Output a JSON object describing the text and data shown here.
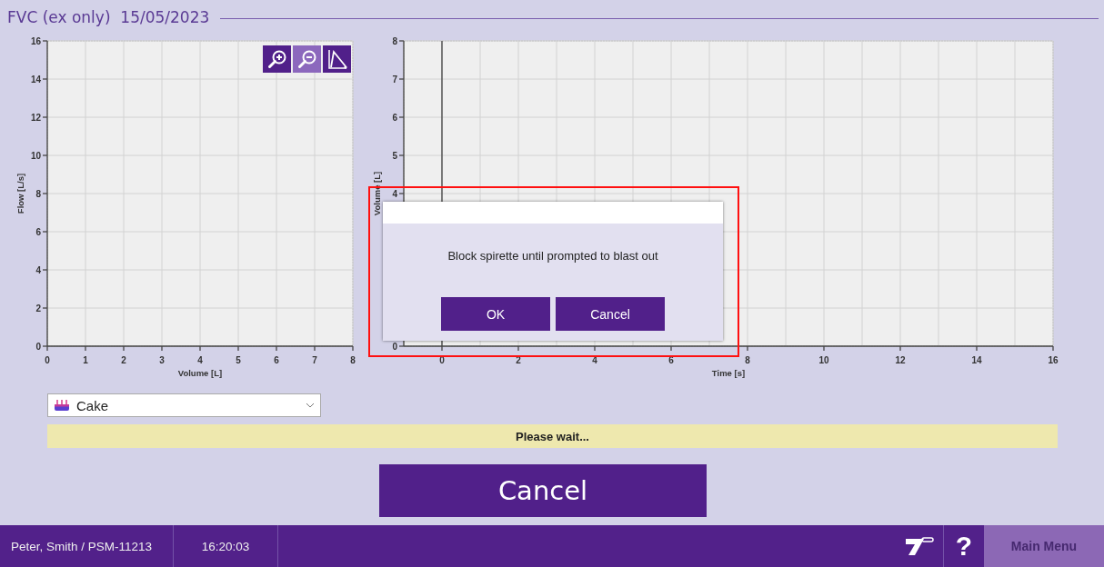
{
  "header": {
    "title": "FVC (ex only)  15/05/2023"
  },
  "charts": [
    {
      "toolbar": [
        {
          "kind": "zoom-in",
          "disabled": false
        },
        {
          "kind": "zoom-out",
          "disabled": true
        },
        {
          "kind": "curve",
          "disabled": false
        }
      ],
      "chart_data": {
        "type": "line",
        "grid": true,
        "xlabel": "Volume [L]",
        "ylabel": "Flow [L/s]",
        "xlim": [
          0,
          8
        ],
        "ylim": [
          0,
          16
        ],
        "xticks": [
          0,
          1,
          2,
          3,
          4,
          5,
          6,
          7,
          8
        ],
        "yticks": [
          0,
          2,
          4,
          6,
          8,
          10,
          12,
          14,
          16
        ]
      }
    },
    {
      "chart_data": {
        "type": "line",
        "grid": true,
        "xlabel": "Time [s]",
        "ylabel": "Volume [L]",
        "xlim": [
          -1,
          16
        ],
        "ylim": [
          0,
          8
        ],
        "xticks": [
          0,
          2,
          4,
          6,
          8,
          10,
          12,
          14,
          16
        ],
        "yticks": [
          0,
          4,
          5,
          6,
          7,
          8
        ]
      }
    }
  ],
  "dropdown": {
    "value": "Cake"
  },
  "status": "Please wait...",
  "cancel_button": "Cancel",
  "dialog": {
    "message": "Block spirette until prompted to blast out",
    "buttons": [
      "OK",
      "Cancel"
    ],
    "highlighted": true
  },
  "footer": {
    "user": "Peter, Smith / PSM-11213",
    "time": "16:20:03",
    "help": "?",
    "main_menu": {
      "label": "Main Menu",
      "disabled": true
    }
  }
}
